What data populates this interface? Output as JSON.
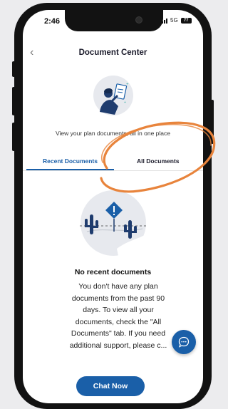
{
  "status_bar": {
    "time": "2:46",
    "network": "5G",
    "battery": "77"
  },
  "header": {
    "back_icon": "chevron-left-icon",
    "title": "Document Center"
  },
  "hero": {
    "icon": "person-with-document-illustration",
    "tagline": "View your plan documents, all in one place"
  },
  "tabs": [
    {
      "label": "Recent Documents",
      "active": true
    },
    {
      "label": "All Documents",
      "active": false
    }
  ],
  "empty_state": {
    "icon": "desert-warning-illustration",
    "title": "No recent documents",
    "body": "You don't have any plan\ndocuments from the past 90\ndays. To view all your\ndocuments, check the \"All\nDocuments\" tab. If you need\nadditional support, please c..."
  },
  "chat_button": {
    "label": "Chat Now",
    "fab_icon": "chat-bubble-icon"
  },
  "colors": {
    "accent": "#1a5fa8",
    "highlight": "#e8843c",
    "frame": "#121212"
  }
}
